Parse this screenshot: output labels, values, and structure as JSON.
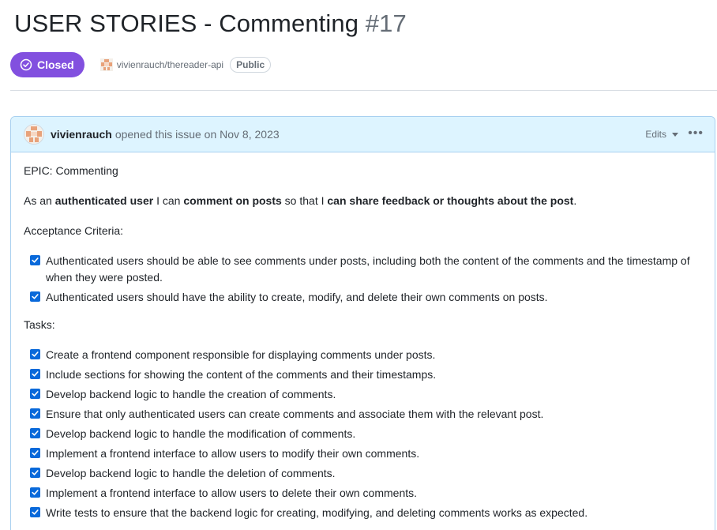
{
  "issue": {
    "title": "USER STORIES - Commenting",
    "number": "#17",
    "state": "Closed",
    "repo": "vivienrauch/thereader-api",
    "visibility": "Public"
  },
  "comment": {
    "author": "vivienrauch",
    "opened_text": "opened this issue on Nov 8, 2023",
    "edits_label": "Edits",
    "more_label": "•••",
    "epic": "EPIC: Commenting",
    "story": {
      "p1": "As an ",
      "b1": "authenticated user",
      "p2": " I can ",
      "b2": "comment on posts",
      "p3": " so that I ",
      "b3": "can share feedback or thoughts about the post",
      "p4": "."
    },
    "acceptance_heading": "Acceptance Criteria:",
    "acceptance_items": [
      "Authenticated users should be able to see comments under posts, including both the content of the comments and the timestamp of when they were posted.",
      "Authenticated users should have the ability to create, modify, and delete their own comments on posts."
    ],
    "tasks_heading": "Tasks:",
    "task_items": [
      "Create a frontend component responsible for displaying comments under posts.",
      "Include sections for showing the content of the comments and their timestamps.",
      "Develop backend logic to handle the creation of comments.",
      "Ensure that only authenticated users can create comments and associate them with the relevant post.",
      "Develop backend logic to handle the modification of comments.",
      "Implement a frontend interface to allow users to modify their own comments.",
      "Develop backend logic to handle the deletion of comments.",
      "Implement a frontend interface to allow users to delete their own comments.",
      "Write tests to ensure that the backend logic for creating, modifying, and deleting comments works as expected."
    ]
  },
  "colors": {
    "closed_badge": "#8250df",
    "header_bg": "#ddf4ff",
    "header_border": "#a8d0f0",
    "checkbox": "#0969da"
  }
}
